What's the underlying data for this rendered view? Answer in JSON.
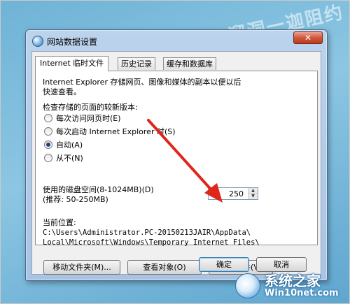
{
  "window": {
    "title": "网站数据设置",
    "close_label": "✕"
  },
  "tabs": [
    {
      "label": "Internet 临时文件"
    },
    {
      "label": "历史记录"
    },
    {
      "label": "缓存和数据库"
    }
  ],
  "panel": {
    "description_line1": "Internet Explorer 存储网页、图像和媒体的副本以便以后",
    "description_line2": "快速查看。",
    "check_label": "检查存储的页面的较新版本:",
    "options": [
      {
        "label": "每次访问网页时(E)",
        "checked": false
      },
      {
        "label": "每次启动 Internet Explorer 时(S)",
        "checked": false
      },
      {
        "label": "自动(A)",
        "checked": true
      },
      {
        "label": "从不(N)",
        "checked": false
      }
    ],
    "disk_label_line1": "使用的磁盘空间(8-1024MB)(D)",
    "disk_label_line2": "(推荐: 50-250MB)",
    "disk_value": "250",
    "location_label": "当前位置:",
    "path_line1": "C:\\Users\\Administrator.PC-20150213JAIR\\AppData\\",
    "path_line2": "Local\\Microsoft\\Windows\\Temporary Internet Files\\"
  },
  "buttons": {
    "move_folder": "移动文件夹(M)...",
    "view_objects": "查看对象(O)",
    "view_files": "查看文件(V)",
    "ok": "确定",
    "cancel": "取消"
  },
  "watermark": {
    "top_text": "溜洞一迦阻约",
    "logo_name": "系统之家",
    "logo_url": "Win10net.com"
  },
  "colors": {
    "background": "#8cc6e2",
    "annotation_arrow": "#e0261b",
    "radio_checked": "#1d3f86"
  }
}
